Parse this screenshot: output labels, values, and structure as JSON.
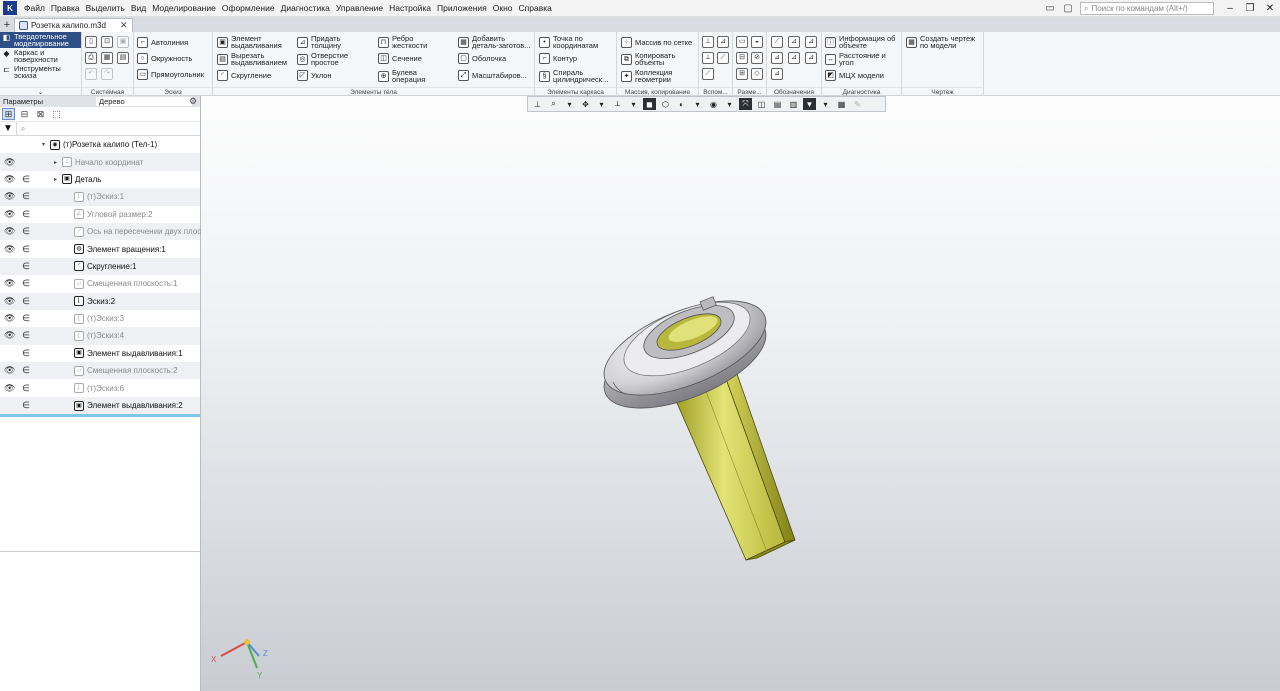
{
  "app": {
    "logo_text": "K"
  },
  "menu": [
    "Файл",
    "Правка",
    "Выделить",
    "Вид",
    "Моделирование",
    "Оформление",
    "Диагностика",
    "Управление",
    "Настройка",
    "Приложения",
    "Окно",
    "Справка"
  ],
  "search": {
    "placeholder": "Поиск по командам (Alt+/)"
  },
  "window": {
    "minimize": "–",
    "restore": "❐",
    "close": "✕"
  },
  "tabs": {
    "add": "+",
    "document_title": "Розетка калипо.m3d",
    "close": "✕"
  },
  "modes": [
    {
      "label": "Твердотельное\nмоделирование",
      "icon": "solid-icon"
    },
    {
      "label": "Каркас и\nповерхности",
      "icon": "wireframe-icon"
    },
    {
      "label": "Инструменты\nэскиза",
      "icon": "sketch-tools-icon"
    }
  ],
  "ribbon": {
    "groups": [
      "Системная",
      "Эскиз",
      "Элементы тела",
      "Элементы каркаса",
      "Массив, копирование",
      "Вспом...",
      "Разме...",
      "Обозначения",
      "Диагностика",
      "Чертеж"
    ],
    "sketch": {
      "autoline": "Автолиния",
      "circle": "Окружность",
      "rectangle": "Прямоугольник"
    },
    "body": {
      "extrude": "Элемент\nвыдавливания",
      "cut_extrude": "Вырезать\nвыдавливанием",
      "fillet": "Скругление",
      "thickness": "Придать\nтолщину",
      "hole": "Отверстие\nпростое",
      "draft": "Уклон",
      "rib": "Ребро\nжесткости",
      "section": "Сечение",
      "boolean": "Булева\nоперация",
      "add_part": "Добавить\nдеталь-заготов...",
      "shell": "Оболочка",
      "scale": "Масштабиров..."
    },
    "frame": {
      "point": "Точка по\nкоординатам",
      "contour": "Контур",
      "spiral": "Спираль\nцилиндрическ..."
    },
    "array": {
      "grid": "Массив по сетке",
      "copy": "Копировать\nобъекты",
      "collection": "Коллекция\nгеометрии"
    },
    "diag": {
      "info": "Информация об\nобъекте",
      "distance": "Расстояние и\nугол",
      "mass": "МЦХ модели"
    },
    "drawing": {
      "create": "Создать чертеж\nпо модели"
    }
  },
  "panel": {
    "tab_params": "Параметры",
    "tab_tree": "Дерево",
    "filter_placeholder": ""
  },
  "tree": [
    {
      "label": "(т)Розетка калипо (Тел-1)",
      "eye": "",
      "rel": "",
      "dim": false,
      "indent": 0,
      "arrow": "▾",
      "icon": "assembly-icon"
    },
    {
      "label": "Начало координат",
      "eye": "👁",
      "rel": "",
      "dim": true,
      "indent": 1,
      "arrow": "▸",
      "icon": "origin-icon"
    },
    {
      "label": "Деталь",
      "eye": "👁",
      "rel": "∈",
      "dim": false,
      "indent": 1,
      "arrow": "▸",
      "icon": "part-icon"
    },
    {
      "label": "(т)Эскиз:1",
      "eye": "👁",
      "rel": "∈",
      "dim": true,
      "indent": 2,
      "arrow": "",
      "icon": "sketch-icon"
    },
    {
      "label": "Угловой размер:2",
      "eye": "👁",
      "rel": "∈",
      "dim": true,
      "indent": 2,
      "arrow": "",
      "icon": "angle-dimension-icon"
    },
    {
      "label": "Ось на пересечении двух плоскост",
      "eye": "👁",
      "rel": "∈",
      "dim": true,
      "indent": 2,
      "arrow": "",
      "icon": "axis-icon"
    },
    {
      "label": "Элемент вращения:1",
      "eye": "👁",
      "rel": "∈",
      "dim": false,
      "indent": 2,
      "arrow": "",
      "icon": "revolve-icon"
    },
    {
      "label": "Скругление:1",
      "eye": "",
      "rel": "∈",
      "dim": false,
      "indent": 2,
      "arrow": "",
      "icon": "fillet-icon"
    },
    {
      "label": "Смещенная плоскость:1",
      "eye": "👁",
      "rel": "∈",
      "dim": true,
      "indent": 2,
      "arrow": "",
      "icon": "plane-icon"
    },
    {
      "label": "Эскиз:2",
      "eye": "👁",
      "rel": "∈",
      "dim": false,
      "indent": 2,
      "arrow": "",
      "icon": "sketch-icon"
    },
    {
      "label": "(т)Эскиз:3",
      "eye": "👁",
      "rel": "∈",
      "dim": true,
      "indent": 2,
      "arrow": "",
      "icon": "sketch-icon"
    },
    {
      "label": "(т)Эскиз:4",
      "eye": "👁",
      "rel": "∈",
      "dim": true,
      "indent": 2,
      "arrow": "",
      "icon": "sketch-icon"
    },
    {
      "label": "Элемент выдавливания:1",
      "eye": "",
      "rel": "∈",
      "dim": false,
      "indent": 2,
      "arrow": "",
      "icon": "extrude-icon"
    },
    {
      "label": "Смещенная плоскость:2",
      "eye": "👁",
      "rel": "∈",
      "dim": true,
      "indent": 2,
      "arrow": "",
      "icon": "plane-icon"
    },
    {
      "label": "(т)Эскиз:6",
      "eye": "👁",
      "rel": "∈",
      "dim": true,
      "indent": 2,
      "arrow": "",
      "icon": "sketch-icon"
    },
    {
      "label": "Элемент выдавливания:2",
      "eye": "",
      "rel": "∈",
      "dim": false,
      "indent": 2,
      "arrow": "",
      "icon": "extrude-icon"
    }
  ],
  "triad": {
    "x": "X",
    "y": "Y",
    "z": "Z"
  },
  "colors": {
    "accent": "#2e4e86",
    "model_yellow": "#d8d85a",
    "model_gray": "#c8c8cc",
    "tree_end": "#7cc6e8"
  }
}
